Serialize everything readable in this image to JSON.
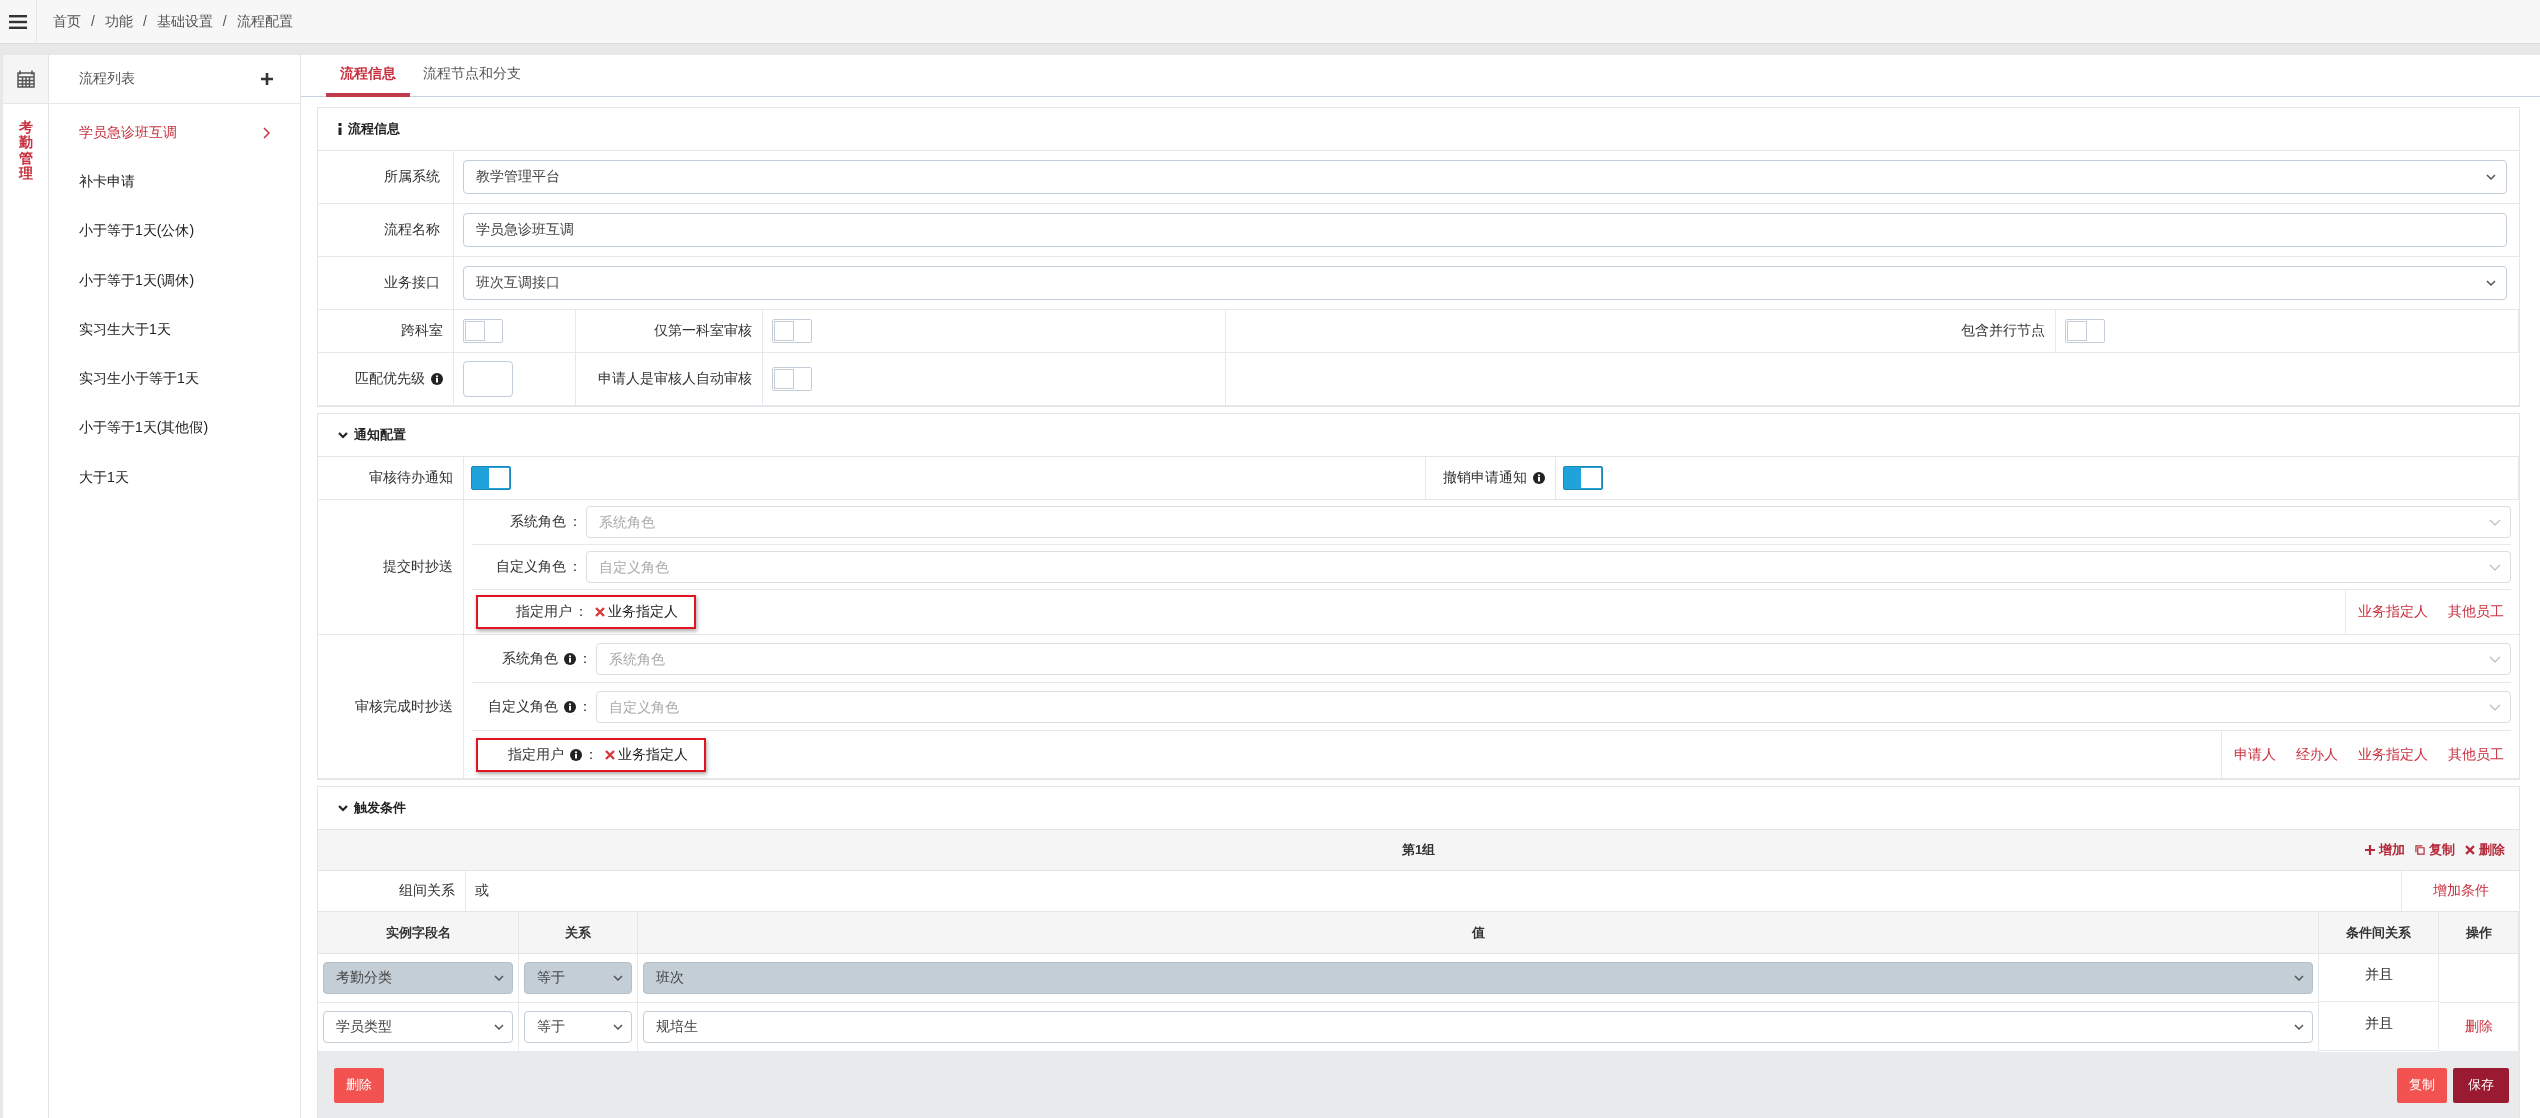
{
  "breadcrumb": {
    "separator": "/",
    "items": [
      "首页",
      "功能",
      "基础设置",
      "流程配置"
    ]
  },
  "rail": {
    "module": "考勤管理"
  },
  "process_list": {
    "title": "流程列表",
    "items": [
      {
        "label": "学员急诊班互调",
        "selected": true
      },
      {
        "label": "补卡申请",
        "selected": false
      },
      {
        "label": "小于等于1天(公休)",
        "selected": false
      },
      {
        "label": "小于等于1天(调休)",
        "selected": false
      },
      {
        "label": "实习生大于1天",
        "selected": false
      },
      {
        "label": "实习生小于等于1天",
        "selected": false
      },
      {
        "label": "小于等于1天(其他假)",
        "selected": false
      },
      {
        "label": "大于1天",
        "selected": false
      }
    ]
  },
  "tabs": [
    {
      "label": "流程信息",
      "selected": true
    },
    {
      "label": "流程节点和分支",
      "selected": false
    }
  ],
  "info_section": {
    "kind": "info",
    "title": "流程信息",
    "fields": [
      {
        "label": "所属系统",
        "kind": "select",
        "value": "教学管理平台"
      },
      {
        "label": "流程名称",
        "kind": "text",
        "value": "学员急诊班互调"
      },
      {
        "label": "业务接口",
        "kind": "select",
        "value": "班次互调接口"
      }
    ],
    "option_rows": [
      [
        {
          "label": "跨科室",
          "kind": "switch",
          "on": false,
          "info": false
        },
        {
          "label": "仅第一科室审核",
          "kind": "switch",
          "on": false,
          "info": false
        },
        {
          "label": "包含并行节点",
          "kind": "switch",
          "on": false,
          "info": false
        }
      ],
      [
        {
          "label": "匹配优先级",
          "kind": "number",
          "info": true
        },
        {
          "label": "申请人是审核人自动审核",
          "kind": "switch",
          "on": false,
          "info": false
        }
      ]
    ]
  },
  "notify_section": {
    "kind": "collapsible",
    "title": "通知配置",
    "expanded": true,
    "switches": [
      {
        "label": "审核待办通知",
        "on": true,
        "info": false
      },
      {
        "label": "撤销申请通知",
        "on": true,
        "info": true
      }
    ],
    "cc_groups": [
      {
        "label": "提交时抄送",
        "rows": [
          {
            "kind": "select",
            "label": "系统角色",
            "info": false,
            "colon": "：",
            "placeholder": "系统角色"
          },
          {
            "kind": "select",
            "label": "自定义角色",
            "info": false,
            "colon": "：",
            "placeholder": "自定义角色"
          },
          {
            "kind": "users",
            "label": "指定用户",
            "info": false,
            "colon": "：",
            "tags": [
              "业务指定人"
            ],
            "highlighted": true,
            "links": [
              "业务指定人",
              "其他员工"
            ]
          }
        ]
      },
      {
        "label": "审核完成时抄送",
        "rows": [
          {
            "kind": "select",
            "label": "系统角色",
            "info": true,
            "colon": "：",
            "placeholder": "系统角色"
          },
          {
            "kind": "select",
            "label": "自定义角色",
            "info": true,
            "colon": "：",
            "placeholder": "自定义角色"
          },
          {
            "kind": "users",
            "label": "指定用户",
            "info": true,
            "colon": "：",
            "tags": [
              "业务指定人"
            ],
            "highlighted": true,
            "links": [
              "申请人",
              "经办人",
              "业务指定人",
              "其他员工"
            ]
          }
        ]
      }
    ]
  },
  "trigger_section": {
    "kind": "collapsible",
    "title": "触发条件",
    "expanded": true,
    "groups": [
      {
        "title": "第1组",
        "actions": [
          {
            "kind": "add",
            "label": "增加"
          },
          {
            "kind": "copy",
            "label": "复制"
          },
          {
            "kind": "delete",
            "label": "删除"
          }
        ],
        "relation_label": "组间关系",
        "relation": "或",
        "add_condition": "增加条件",
        "columns": [
          "实例字段名",
          "关系",
          "值",
          "条件间关系",
          "操作"
        ],
        "rows": [
          {
            "field": "考勤分类",
            "op": "等于",
            "value": "班次",
            "join": "并且",
            "disabled": true
          },
          {
            "field": "学员类型",
            "op": "等于",
            "value": "规培生",
            "join": "并且",
            "disabled": false,
            "action": "删除"
          }
        ]
      }
    ],
    "buttons": [
      {
        "kind": "danger",
        "label": "删除"
      },
      {
        "kind": "danger",
        "label": "复制"
      },
      {
        "kind": "primary",
        "label": "保存"
      }
    ]
  }
}
